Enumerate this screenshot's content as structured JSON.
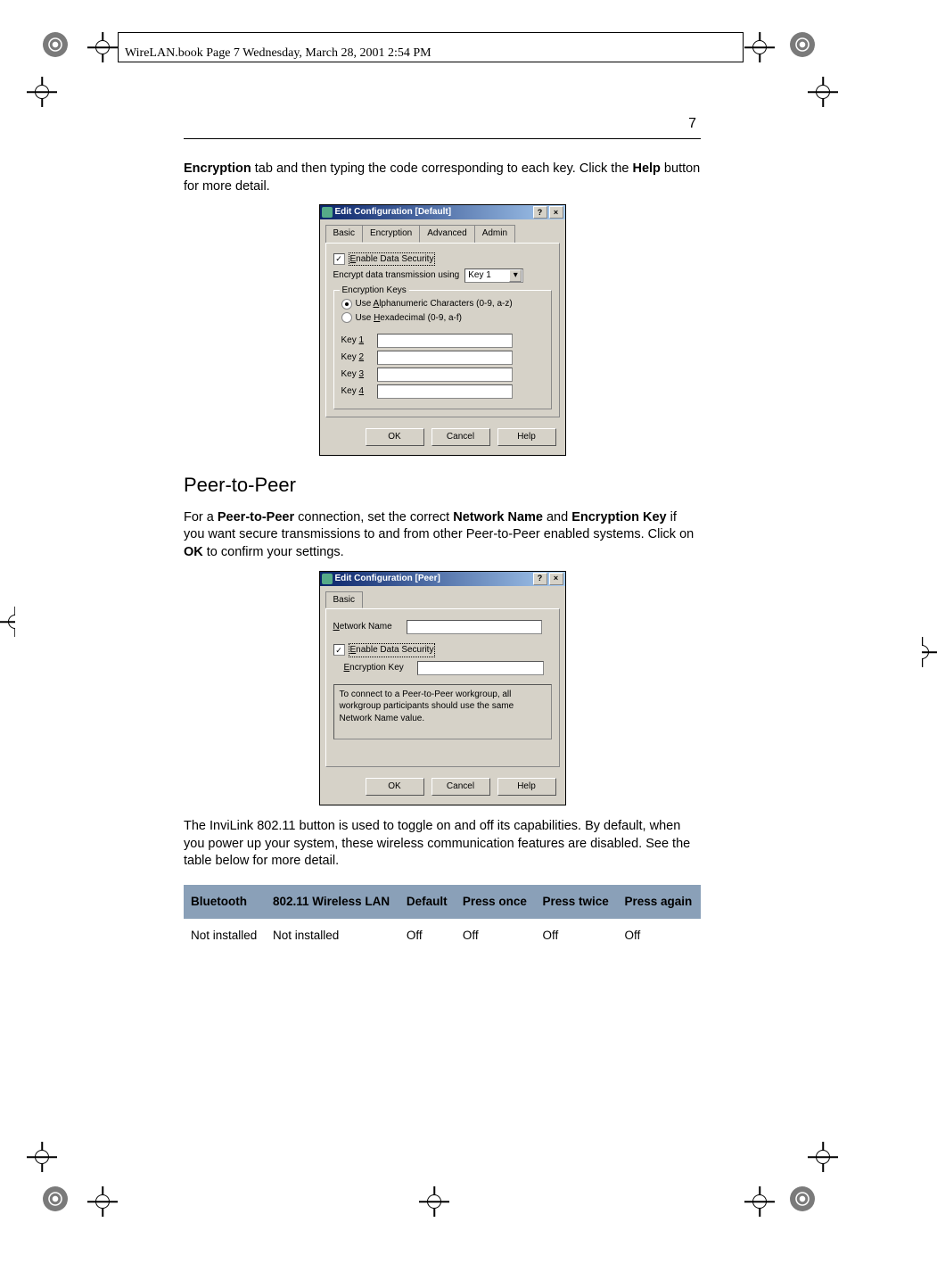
{
  "header": "WireLAN.book  Page 7  Wednesday, March 28, 2001  2:54 PM",
  "page_number": "7",
  "para1_before": "Encryption",
  "para1_mid": " tab and then typing the code corresponding to each key.  Click the ",
  "para1_bold2": "Help",
  "para1_after": " button for more detail.",
  "dialog1": {
    "title": "Edit Configuration [Default]",
    "help": "?",
    "close": "×",
    "tabs": {
      "basic": "Basic",
      "encryption": "Encryption",
      "advanced": "Advanced",
      "admin": "Admin"
    },
    "enable_label": "Enable Data Security",
    "encrypt_using": "Encrypt data transmission using",
    "key_selected": "Key 1",
    "fieldset_legend": "Encryption Keys",
    "radio_alpha_pre": "Use ",
    "radio_alpha_u": "A",
    "radio_alpha_post": "lphanumeric Characters (0-9, a-z)",
    "radio_hex_pre": "Use ",
    "radio_hex_u": "H",
    "radio_hex_post": "exadecimal (0-9, a-f)",
    "key_labels": {
      "k1": "Key 1",
      "k2": "Key 2",
      "k3": "Key 3",
      "k4": "Key 4"
    },
    "ok": "OK",
    "cancel": "Cancel",
    "helpbtn": "Help"
  },
  "section_title": "Peer-to-Peer",
  "para2_a": "For a ",
  "para2_b": "Peer-to-Peer",
  "para2_c": " connection, set the correct ",
  "para2_d": "Network Name",
  "para2_e": " and ",
  "para2_f": "Encryption Key",
  "para2_g": " if you want secure transmissions to and from other Peer-to-Peer enabled systems.  Click on ",
  "para2_h": "OK",
  "para2_i": " to confirm your settings.",
  "dialog2": {
    "title": "Edit Configuration [Peer]",
    "help": "?",
    "close": "×",
    "tab_basic": "Basic",
    "net_pre": "N",
    "net_post": "etwork Name",
    "enable_label": "Enable Data Security",
    "enc_pre": "E",
    "enc_post": "ncryption Key",
    "info": "To connect to a Peer-to-Peer workgroup, all workgroup participants should use the same Network Name value.",
    "ok": "OK",
    "cancel": "Cancel",
    "helpbtn": "Help"
  },
  "para3": "The InviLink 802.11 button is used to toggle on and off its capabilities. By default, when you power up your system, these wireless communication features are disabled.  See the table below for more detail.",
  "table": {
    "headers": {
      "h1": "Bluetooth",
      "h2": "802.11 Wireless LAN",
      "h3": "Default",
      "h4": "Press once",
      "h5": "Press twice",
      "h6": "Press again"
    },
    "row1": {
      "c1": "Not installed",
      "c2": "Not installed",
      "c3": "Off",
      "c4": "Off",
      "c5": "Off",
      "c6": "Off"
    }
  }
}
